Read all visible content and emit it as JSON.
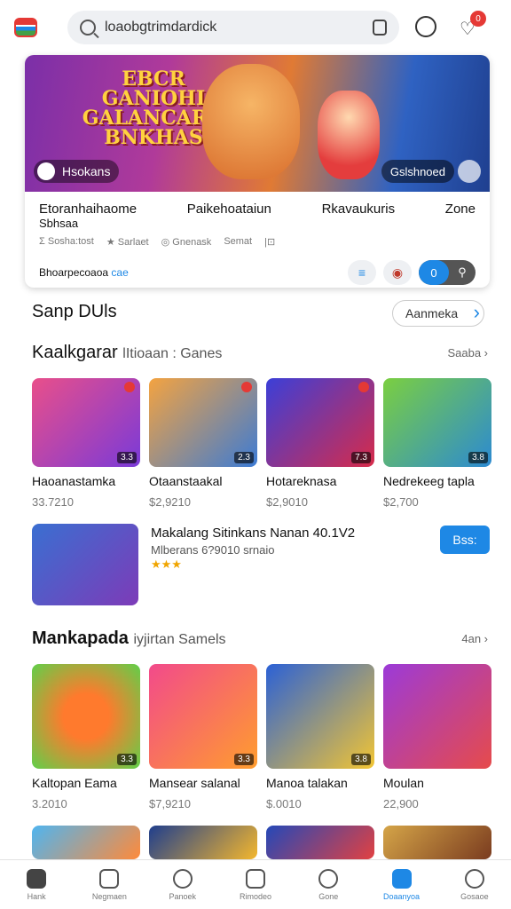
{
  "search": {
    "value": "loaobgtrimdardick",
    "placeholder": ""
  },
  "notifications_count": "0",
  "hero": {
    "banner_title": "EBCR GANIOHI GALANCARO BNKHAS",
    "user_label": "Hsokans",
    "chip_label": "Gslshnoed",
    "columns": [
      {
        "title": "Etoranhaihaome",
        "sub": "Sbhsaa"
      },
      {
        "title": "Paikehoataiun",
        "sub": ""
      },
      {
        "title": "Rkavaukuris",
        "sub": ""
      },
      {
        "title": "Zone",
        "sub": ""
      }
    ],
    "meta": [
      "Σ Sosha:tost",
      "★ Sarlaet",
      "◎ Gnenask",
      "Semat",
      "|⊡"
    ],
    "footer_text": "Bhoarpecoaoa",
    "footer_link": "cae",
    "seg_value": "0"
  },
  "section1": {
    "title": "Sanp DUls",
    "button": "Aanmeka"
  },
  "section2": {
    "title": "Kaalkgarar",
    "subtitle": "lItioaan : Ganes",
    "more": "Saaba ›"
  },
  "row1": [
    {
      "title": "Haoanastamka",
      "price": "33.7210",
      "tag": "3.3",
      "colors": [
        "#e94f8a",
        "#7a3ad8"
      ]
    },
    {
      "title": "Otaanstaakal",
      "price": "$2,9210",
      "tag": "2.3",
      "colors": [
        "#f4a340",
        "#3c7bd4"
      ]
    },
    {
      "title": "Hotareknasa",
      "price": "$2,9010",
      "tag": "7.3",
      "colors": [
        "#3b3fd8",
        "#d72b4a"
      ]
    },
    {
      "title": "Nedrekeeg tapla",
      "price": "$2,700",
      "tag": "3.8",
      "colors": [
        "#7bcf40",
        "#2c8ad2"
      ]
    }
  ],
  "featured": {
    "title": "Makalang Sitinkans Nanan 40.1V2",
    "meta": "Mlberans 6?9010 srnaio",
    "stars": "★★★",
    "button": "Bss:"
  },
  "section3": {
    "title": "Mankapada",
    "subtitle": "iyjirtan Samels",
    "more": "4an ›"
  },
  "row2": [
    {
      "title": "Kaltopan Eama",
      "price": "3.2010",
      "tag": "3.3",
      "colors": [
        "#ff7a2d",
        "#5fd04a"
      ]
    },
    {
      "title": "Mansear salanal",
      "price": "$7,9210",
      "tag": "3.3",
      "colors": [
        "#f24a8b",
        "#ff9d2e"
      ]
    },
    {
      "title": "Manoa talakan",
      "price": "$.0010",
      "tag": "3.8",
      "colors": [
        "#2b61d6",
        "#f2c533"
      ]
    },
    {
      "title": "Moulan",
      "price": "22,900",
      "tag": "",
      "colors": [
        "#9c3ad8",
        "#e64b4b"
      ]
    }
  ],
  "row3": [
    {
      "colors": [
        "#4fb5f0",
        "#ff8a3a"
      ]
    },
    {
      "colors": [
        "#1f3e8d",
        "#f4b72d"
      ]
    },
    {
      "colors": [
        "#2448b8",
        "#e24141"
      ]
    },
    {
      "colors": [
        "#d5a548",
        "#7a3b1f"
      ]
    }
  ],
  "nav": [
    "Hank",
    "Negmaen",
    "Panoek",
    "Rimodeo",
    "Gone",
    "Doaanyoa",
    "Gosaoe"
  ]
}
